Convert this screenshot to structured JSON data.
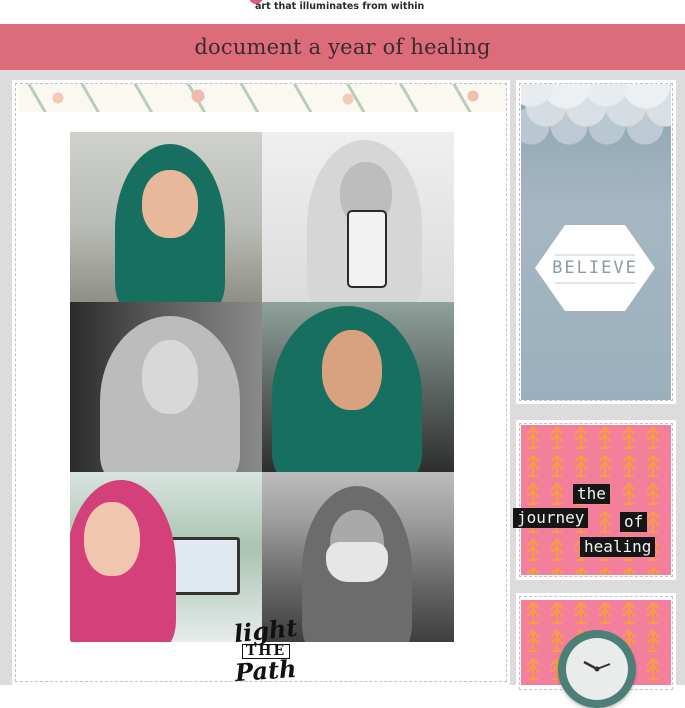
{
  "header": {
    "tagline": "art that illuminates from within",
    "title": "document a year of healing"
  },
  "layout_cards": {
    "believe": {
      "word": "BELIEVE"
    },
    "journey": {
      "words": [
        "the",
        "journey",
        "of",
        "healing"
      ]
    }
  },
  "stamp": {
    "line1": "light",
    "line2": "THE",
    "line3": "Path"
  },
  "colors": {
    "header_band": "#dd6c7b",
    "frame_bg": "#dcdcdc",
    "pink_pattern": "#f47f9c",
    "arrow_accent": "#f6a03d",
    "sky_blue": "#9aafbd",
    "teal_clock": "#4c7f77"
  },
  "photos": [
    {
      "id": "photo-1",
      "hijab": "#17705f",
      "tone": "color"
    },
    {
      "id": "photo-2",
      "hijab": "#d6d6d6",
      "tone": "grayscale"
    },
    {
      "id": "photo-3",
      "hijab": "#bcbcbc",
      "tone": "grayscale"
    },
    {
      "id": "photo-4",
      "hijab": "#17705f",
      "tone": "color"
    },
    {
      "id": "photo-5",
      "hijab": "#d4407a",
      "tone": "color"
    },
    {
      "id": "photo-6",
      "hijab": "#6c6c6c",
      "tone": "grayscale"
    }
  ]
}
